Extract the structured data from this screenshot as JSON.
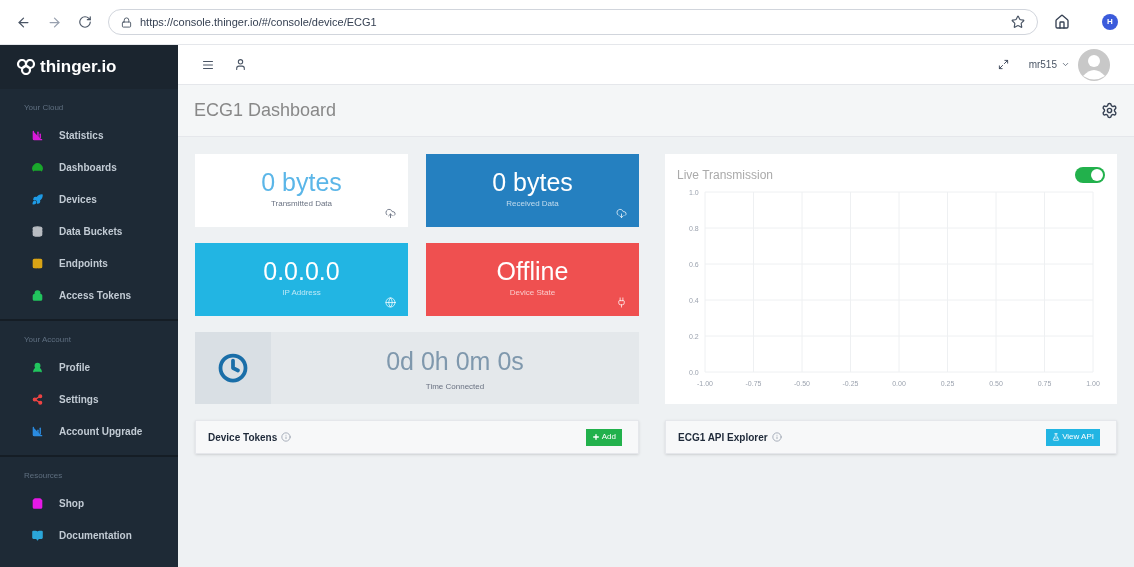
{
  "browser": {
    "url": "https://console.thinger.io/#/console/device/ECG1",
    "profile_initial": "H"
  },
  "sidebar": {
    "logo": "thinger.io",
    "sections": [
      {
        "heading": "Your Cloud",
        "items": [
          {
            "label": "Statistics",
            "color": "#d81bd8"
          },
          {
            "label": "Dashboards",
            "color": "#1aa82c"
          },
          {
            "label": "Devices",
            "color": "#1e9be6"
          },
          {
            "label": "Data Buckets",
            "color": "#b8bcc2"
          },
          {
            "label": "Endpoints",
            "color": "#d9a416"
          },
          {
            "label": "Access Tokens",
            "color": "#22c55e"
          }
        ]
      },
      {
        "heading": "Your Account",
        "items": [
          {
            "label": "Profile",
            "color": "#22c55e"
          },
          {
            "label": "Settings",
            "color": "#ef4444"
          },
          {
            "label": "Account Upgrade",
            "color": "#2b8be0"
          }
        ]
      },
      {
        "heading": "Resources",
        "items": [
          {
            "label": "Shop",
            "color": "#e619e6"
          },
          {
            "label": "Documentation",
            "color": "#2ba6d9"
          }
        ]
      }
    ]
  },
  "topbar": {
    "user": "mr515"
  },
  "page_title": "ECG1 Dashboard",
  "stats": [
    {
      "value": "0 bytes",
      "label": "Transmitted Data",
      "color": "#ffffff"
    },
    {
      "value": "0 bytes",
      "label": "Received Data",
      "color": "#2580c0"
    },
    {
      "value": "0.0.0.0",
      "label": "IP Address",
      "color": "#22b5e3"
    },
    {
      "value": "Offline",
      "label": "Device State",
      "color": "#ef5050"
    }
  ],
  "time_connected": {
    "value": "0d 0h 0m 0s",
    "label": "Time Connected"
  },
  "device_tokens": {
    "title": "Device Tokens",
    "button": "Add"
  },
  "live_transmission": {
    "title": "Live Transmission",
    "on": true,
    "chart_data": {
      "type": "line",
      "grid": true,
      "xlim": [
        -1,
        1
      ],
      "ylim": [
        0,
        1
      ],
      "xticks": [
        {
          "value": -1,
          "label": "-1.00"
        },
        {
          "value": -0.75,
          "label": "-0.75"
        },
        {
          "value": -0.5,
          "label": "-0.50"
        },
        {
          "value": -0.25,
          "label": "-0.25"
        },
        {
          "value": 0,
          "label": "0.00"
        },
        {
          "value": 0.25,
          "label": "0.25"
        },
        {
          "value": 0.5,
          "label": "0.50"
        },
        {
          "value": 0.75,
          "label": "0.75"
        },
        {
          "value": 1,
          "label": "1.00"
        }
      ],
      "yticks": [
        {
          "value": 0,
          "label": "0.0"
        },
        {
          "value": 0.2,
          "label": "0.2"
        },
        {
          "value": 0.4,
          "label": "0.4"
        },
        {
          "value": 0.6,
          "label": "0.6"
        },
        {
          "value": 0.8,
          "label": "0.8"
        },
        {
          "value": 1,
          "label": "1.0"
        }
      ]
    }
  },
  "api_explorer": {
    "title": "ECG1 API Explorer",
    "button": "View API"
  }
}
